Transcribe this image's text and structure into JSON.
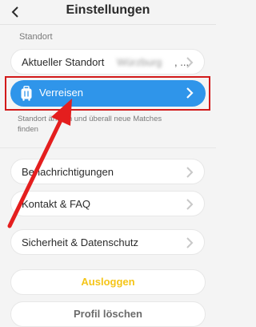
{
  "header": {
    "title": "Einstellungen",
    "back_icon": "chevron-left-icon"
  },
  "section": {
    "label": "Standort"
  },
  "location_row": {
    "label": "Aktueller Standort",
    "value_blurred": "Würzburg",
    "ellipsis": ", ..."
  },
  "travel_row": {
    "label": "Verreisen",
    "icon": "suitcase-icon",
    "accent": "#2f95ea"
  },
  "helper_text": "Standort ändern und überall neue Matches finden",
  "menu": {
    "notifications": "Benachrichtigungen",
    "contact": "Kontakt & FAQ",
    "security": "Sicherheit & Datenschutz"
  },
  "actions": {
    "logout": "Ausloggen",
    "logout_color": "#f5c518",
    "delete_profile": "Profil löschen"
  },
  "annotation": {
    "box_color": "#d21a1a",
    "arrow_color": "#e41e1e"
  }
}
